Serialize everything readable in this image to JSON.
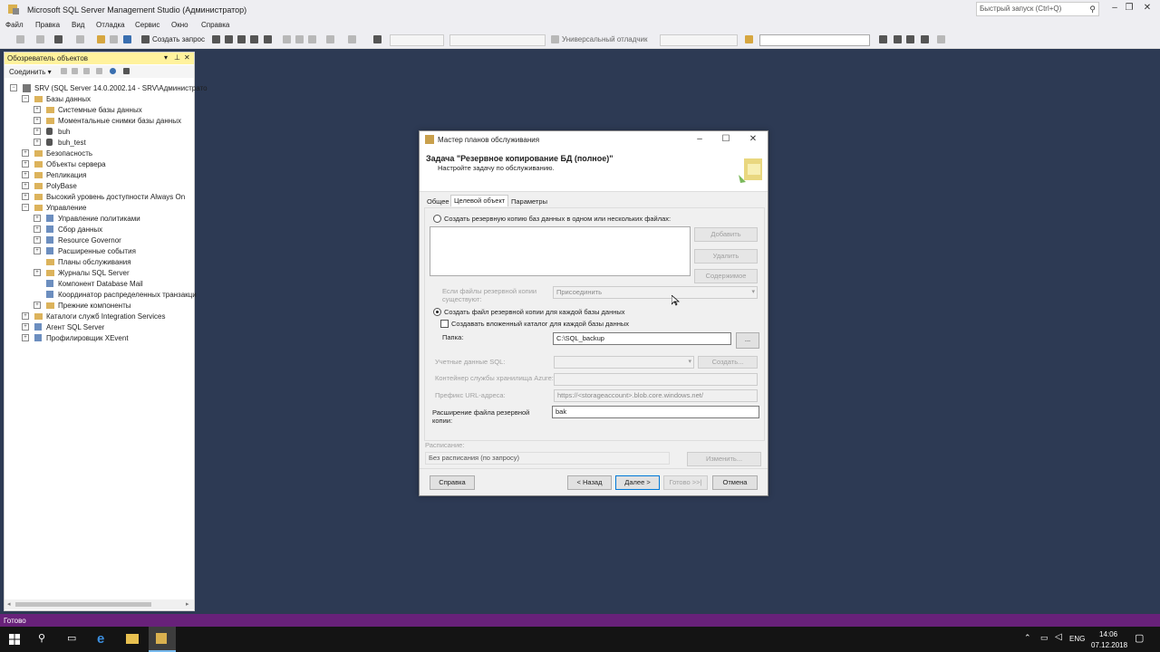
{
  "app": {
    "title": "Microsoft SQL Server Management Studio (Администратор)",
    "quick_launch_placeholder": "Быстрый запуск (Ctrl+Q)",
    "window_buttons": {
      "minimize": "–",
      "maximize": "❐",
      "close": "✕"
    }
  },
  "menu": [
    "Файл",
    "Правка",
    "Вид",
    "Отладка",
    "Сервис",
    "Окно",
    "Справка"
  ],
  "toolbar": {
    "new_query": "Создать запрос",
    "debugger": "Универсальный отладчик"
  },
  "object_explorer": {
    "title": "Обозреватель объектов",
    "connect": "Соединить ▾",
    "tree": [
      {
        "label": "SRV (SQL Server 14.0.2002.14 - SRV\\Администрато",
        "level": 0,
        "exp": "−",
        "icon": "server"
      },
      {
        "label": "Базы данных",
        "level": 1,
        "exp": "−",
        "icon": "folder"
      },
      {
        "label": "Системные базы данных",
        "level": 2,
        "exp": "+",
        "icon": "folder"
      },
      {
        "label": "Моментальные снимки базы данных",
        "level": 2,
        "exp": "+",
        "icon": "folder"
      },
      {
        "label": "buh",
        "level": 2,
        "exp": "+",
        "icon": "database"
      },
      {
        "label": "buh_test",
        "level": 2,
        "exp": "+",
        "icon": "database"
      },
      {
        "label": "Безопасность",
        "level": 1,
        "exp": "+",
        "icon": "folder"
      },
      {
        "label": "Объекты сервера",
        "level": 1,
        "exp": "+",
        "icon": "folder"
      },
      {
        "label": "Репликация",
        "level": 1,
        "exp": "+",
        "icon": "folder"
      },
      {
        "label": "PolyBase",
        "level": 1,
        "exp": "+",
        "icon": "folder"
      },
      {
        "label": "Высокий уровень доступности Always On",
        "level": 1,
        "exp": "+",
        "icon": "folder"
      },
      {
        "label": "Управление",
        "level": 1,
        "exp": "−",
        "icon": "folder"
      },
      {
        "label": "Управление политиками",
        "level": 2,
        "exp": "+",
        "icon": "generic"
      },
      {
        "label": "Сбор данных",
        "level": 2,
        "exp": "+",
        "icon": "generic"
      },
      {
        "label": "Resource Governor",
        "level": 2,
        "exp": "+",
        "icon": "generic"
      },
      {
        "label": "Расширенные события",
        "level": 2,
        "exp": "+",
        "icon": "generic"
      },
      {
        "label": "Планы обслуживания",
        "level": 2,
        "exp": "",
        "icon": "folder"
      },
      {
        "label": "Журналы SQL Server",
        "level": 2,
        "exp": "+",
        "icon": "folder"
      },
      {
        "label": "Компонент Database Mail",
        "level": 2,
        "exp": "",
        "icon": "generic"
      },
      {
        "label": "Координатор распределенных транзакци",
        "level": 2,
        "exp": "",
        "icon": "generic"
      },
      {
        "label": "Прежние компоненты",
        "level": 2,
        "exp": "+",
        "icon": "folder"
      },
      {
        "label": "Каталоги служб Integration Services",
        "level": 1,
        "exp": "+",
        "icon": "folder"
      },
      {
        "label": "Агент SQL Server",
        "level": 1,
        "exp": "+",
        "icon": "generic"
      },
      {
        "label": "Профилировщик XEvent",
        "level": 1,
        "exp": "+",
        "icon": "generic"
      }
    ]
  },
  "status": "Готово",
  "taskbar": {
    "lang": "ENG",
    "time": "14:06",
    "date": "07.12.2018"
  },
  "dialog": {
    "title": "Мастер планов обслуживания",
    "heading": "Задача \"Резервное копирование БД (полное)\"",
    "subheading": "Настройте задачу по обслуживанию.",
    "tabs": [
      "Общее",
      "Целевой объект",
      "Параметры"
    ],
    "radio_one_file": "Создать резервную копию баз данных в одном или нескольких файлах:",
    "btn_add": "Добавить",
    "btn_remove": "Удалить",
    "btn_contents": "Содержимое",
    "if_exists_label": "Если файлы резервной копии существуют:",
    "if_exists_value": "Присоединить",
    "radio_per_db": "Создать файл резервной копии для каждой базы данных",
    "chk_subdir": "Создавать вложенный каталог для каждой базы данных",
    "folder_label": "Папка:",
    "folder_value": "C:\\SQL_backup",
    "browse": "...",
    "sql_cred_label": "Учетные данные SQL:",
    "btn_create": "Создать...",
    "azure_label": "Контейнер службы хранилища Azure:",
    "url_prefix_label": "Префикс URL-адреса:",
    "url_prefix_value": "https://<storageaccount>.blob.core.windows.net/",
    "ext_label": "Расширение файла резервной копии:",
    "ext_value": "bak",
    "schedule_label": "Расписание:",
    "schedule_value": "Без расписания (по запросу)",
    "btn_change": "Изменить...",
    "btn_help": "Справка",
    "btn_back": "< Назад",
    "btn_next": "Далее >",
    "btn_finish": "Готово >>|",
    "btn_cancel": "Отмена"
  }
}
